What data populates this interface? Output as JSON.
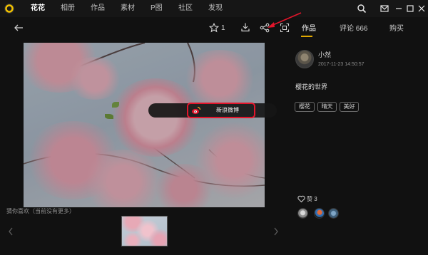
{
  "nav": {
    "items": [
      {
        "label": "花花",
        "active": true
      },
      {
        "label": "相册",
        "active": false
      },
      {
        "label": "作品",
        "active": false
      },
      {
        "label": "素材",
        "active": false
      },
      {
        "label": "P图",
        "active": false
      },
      {
        "label": "社区",
        "active": false
      },
      {
        "label": "发现",
        "active": false
      }
    ],
    "icons": [
      "search-icon",
      "mail-icon",
      "minimize-icon",
      "maximize-icon",
      "close-icon"
    ]
  },
  "toolbar": {
    "favorite_count": "1",
    "icons": [
      "back-arrow-icon",
      "star-icon",
      "download-icon",
      "share-icon",
      "crop-icon"
    ]
  },
  "tabs": [
    {
      "label": "作品",
      "active": true
    },
    {
      "label": "评论 666",
      "active": false
    },
    {
      "label": "购买",
      "active": false
    }
  ],
  "share_popup": {
    "weibo_label": "新浪微博",
    "highlight_color": "#e3152b"
  },
  "author": {
    "name": "小然",
    "timestamp": "2017-11-23 14:50:57"
  },
  "post": {
    "description": "樱花的世界",
    "tags": [
      "樱花",
      "晴天",
      "美好"
    ]
  },
  "likes": {
    "label": "赞 3"
  },
  "recommendations": {
    "label": "猜你喜欢（当前没有更多）"
  },
  "colors": {
    "background": "#111111",
    "accent": "#e0a800",
    "annotation_arrow": "#e3152b"
  }
}
